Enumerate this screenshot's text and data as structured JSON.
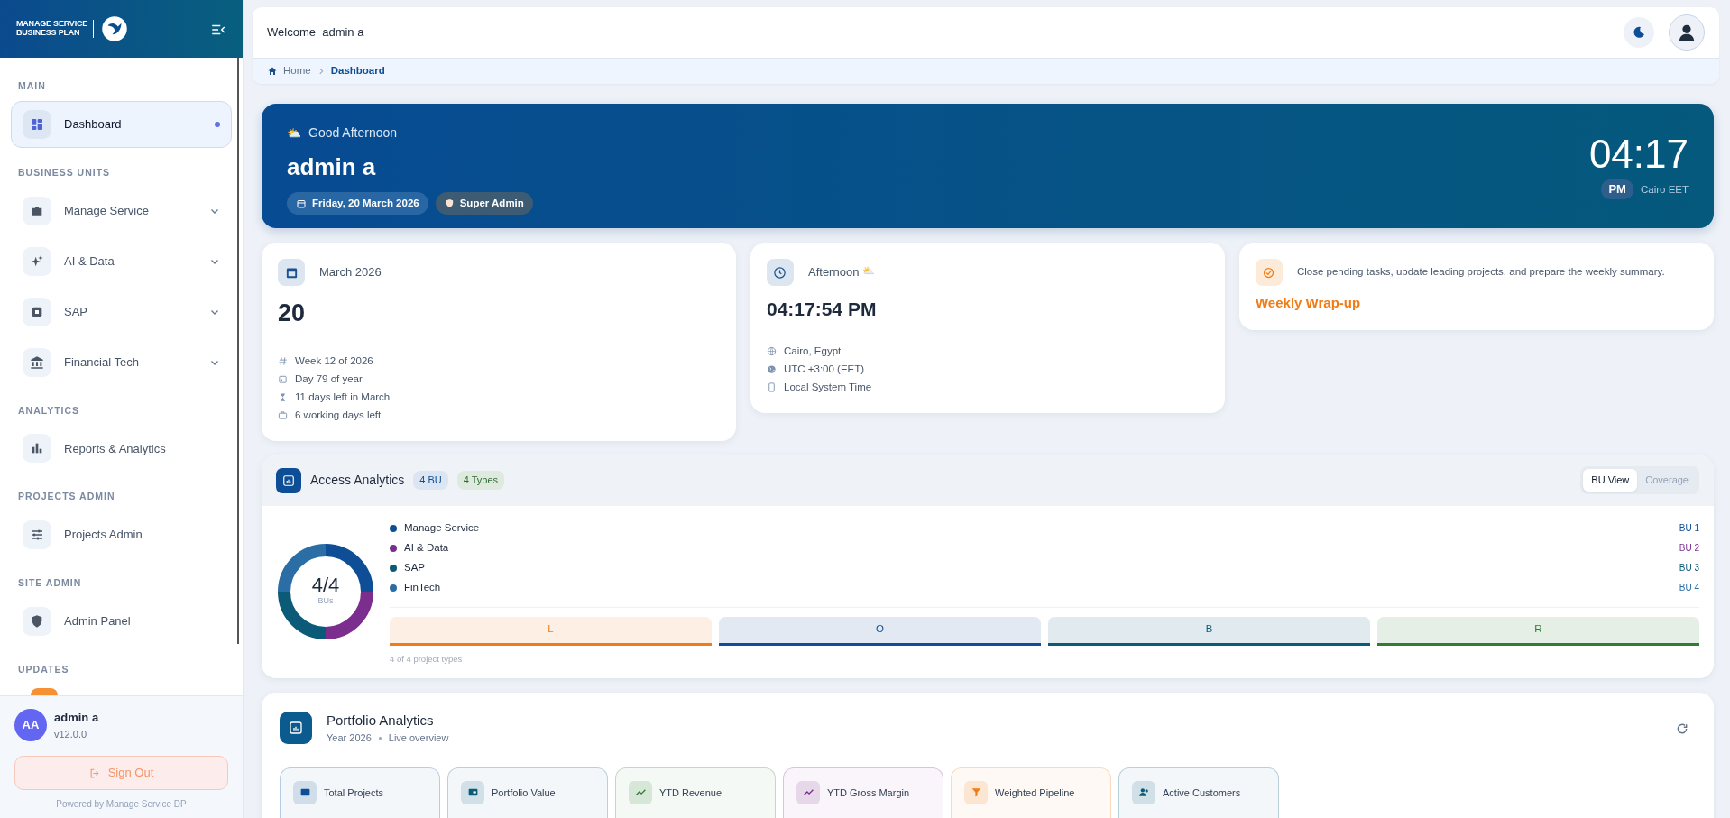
{
  "brand": {
    "line_1": "MANAGE SERVICE",
    "line_2": "BUSINESS PLAN"
  },
  "sidebar": {
    "sections": [
      {
        "title": "MAIN",
        "items": [
          {
            "label": "Dashboard",
            "kind": "link",
            "selected": true
          }
        ]
      },
      {
        "title": "BUSINESS UNITS",
        "items": [
          {
            "label": "Manage Service",
            "kind": "group",
            "selected": false
          },
          {
            "label": "AI & Data",
            "kind": "group",
            "selected": false
          },
          {
            "label": "SAP",
            "kind": "group",
            "selected": false
          },
          {
            "label": "Financial Tech",
            "kind": "group",
            "selected": false
          }
        ]
      },
      {
        "title": "ANALYTICS",
        "items": [
          {
            "label": "Reports & Analytics",
            "kind": "link",
            "selected": false
          }
        ]
      },
      {
        "title": "PROJECTS ADMIN",
        "items": [
          {
            "label": "Projects Admin",
            "kind": "link",
            "selected": false
          }
        ]
      },
      {
        "title": "SITE ADMIN",
        "items": [
          {
            "label": "Admin Panel",
            "kind": "link",
            "selected": false
          }
        ]
      },
      {
        "title": "UPDATES",
        "items": [
          {
            "kind": "update"
          }
        ]
      }
    ],
    "user": {
      "initials": "AA",
      "name": "admin a",
      "version": "v12.0.0"
    },
    "sign_out": "Sign Out",
    "powered_by": "Powered by Manage Service DP"
  },
  "header": {
    "welcome": "Welcome  admin a",
    "breadcrumb": [
      {
        "label": "Home",
        "selected": false
      },
      {
        "label": "Dashboard",
        "selected": true
      }
    ]
  },
  "hero": {
    "weather": "⛅",
    "greeting": "Good Afternoon",
    "name": "admin a",
    "date": "Friday, 20 March 2026",
    "role": "Super Admin",
    "time": "04:17",
    "period": "PM",
    "zone": "Cairo EET"
  },
  "date_card": {
    "month": "March 2026",
    "day": "20",
    "facts": [
      "Week 12 of 2026",
      "Day 79 of year",
      "11 days left in March",
      "6 working days left"
    ]
  },
  "time_card": {
    "period": "Afternoon",
    "weather": "⛅",
    "time": "04:17:54 PM",
    "facts": [
      "Cairo, Egypt",
      "UTC +3:00 (EET)",
      "Local System Time"
    ]
  },
  "task_card": {
    "text": "Close pending tasks, update leading projects, and prepare the weekly summary.",
    "title": "Weekly Wrap-up"
  },
  "access_analytics": {
    "title": "Access Analytics",
    "badges": [
      "4 BU",
      "4 Types"
    ],
    "views": [
      {
        "label": "BU View",
        "selected": true
      },
      {
        "label": "Coverage",
        "selected": false
      }
    ],
    "donut_value": "4/4",
    "donut_label": "BUs",
    "units": [
      {
        "name": "Manage Service",
        "code": "BU 1",
        "color": "#0d4e96"
      },
      {
        "name": "AI & Data",
        "code": "BU 2",
        "color": "#7b2e8e"
      },
      {
        "name": "SAP",
        "code": "BU 3",
        "color": "#0b5b78"
      },
      {
        "name": "FinTech",
        "code": "BU 4",
        "color": "#2b6ea6"
      }
    ],
    "types": [
      {
        "label": "L",
        "color": "#f07c16"
      },
      {
        "label": "O",
        "color": "#0d4e96"
      },
      {
        "label": "B",
        "color": "#0b5b78"
      },
      {
        "label": "R",
        "color": "#2e7d32"
      }
    ],
    "types_note": "4 of 4 project types"
  },
  "portfolio": {
    "title": "Portfolio Analytics",
    "year": "Year 2026",
    "subtitle": "Live overview",
    "kpis": [
      {
        "label": "Total Projects",
        "color": "#0d4e96"
      },
      {
        "label": "Portfolio Value",
        "color": "#0b5b78"
      },
      {
        "label": "YTD Revenue",
        "color": "#2e7d32"
      },
      {
        "label": "YTD Gross Margin",
        "color": "#7b2e8e"
      },
      {
        "label": "Weighted Pipeline",
        "color": "#f07c16"
      },
      {
        "label": "Active Customers",
        "color": "#0b5b78"
      }
    ]
  }
}
